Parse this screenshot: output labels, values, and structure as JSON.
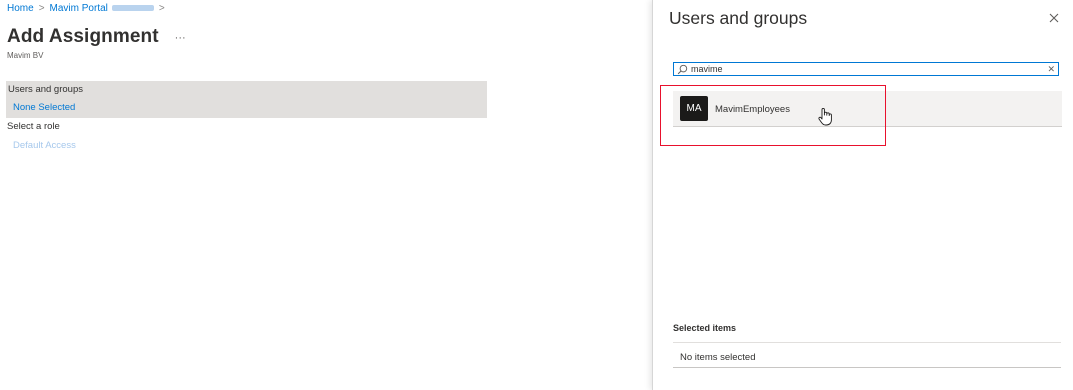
{
  "breadcrumb": {
    "home": "Home",
    "portal": "Mavim Portal"
  },
  "page": {
    "title": "Add Assignment",
    "more": "···",
    "subtitle": "Mavim BV"
  },
  "form": {
    "users_label": "Users and groups",
    "users_value": "None Selected",
    "role_label": "Select a role",
    "role_value": "Default Access"
  },
  "panel": {
    "title": "Users and groups",
    "search_value": "mavime",
    "results": [
      {
        "initials": "MA",
        "name": "MavimEmployees"
      }
    ],
    "selected_title": "Selected items",
    "selected_empty": "No items selected"
  },
  "colors": {
    "accent": "#0078d4",
    "highlight": "#e8112d",
    "avatar_bg": "#1b1a19",
    "selected_block": "#e1dfdd"
  },
  "icons": [
    "chevron-right-icon",
    "more-icon",
    "close-icon",
    "search-icon",
    "clear-icon",
    "hand-cursor-icon"
  ]
}
